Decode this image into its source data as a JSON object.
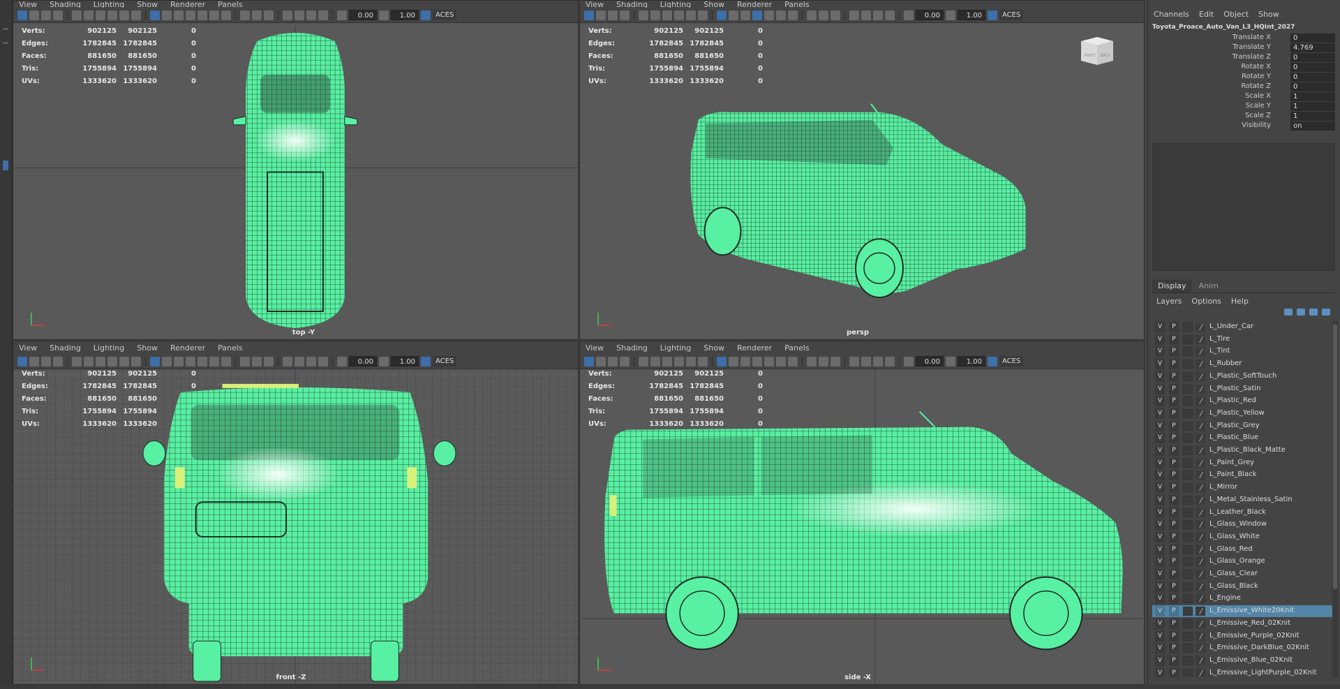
{
  "viewport_menu": [
    "View",
    "Shading",
    "Lighting",
    "Show",
    "Renderer",
    "Panels"
  ],
  "toolbar": {
    "value_a": "0.00",
    "value_b": "1.00",
    "color_space": "ACES"
  },
  "stats": {
    "rows": [
      {
        "label": "Verts:",
        "v1": "902125",
        "v2": "902125",
        "v3": "0"
      },
      {
        "label": "Edges:",
        "v1": "1782845",
        "v2": "1782845",
        "v3": "0"
      },
      {
        "label": "Faces:",
        "v1": "881650",
        "v2": "881650",
        "v3": "0"
      },
      {
        "label": "Tris:",
        "v1": "1755894",
        "v2": "1755894",
        "v3": "0"
      },
      {
        "label": "UVs:",
        "v1": "1333620",
        "v2": "1333620",
        "v3": "0"
      }
    ]
  },
  "viewports": {
    "top": {
      "label": "top -Y"
    },
    "persp": {
      "label": "persp",
      "cube_right": "RIGHT",
      "cube_back": "BACK"
    },
    "front": {
      "label": "front -Z"
    },
    "side": {
      "label": "side -X"
    }
  },
  "right_panel": {
    "menu": [
      "Channels",
      "Edit",
      "Object",
      "Show"
    ],
    "object_name": "Toyota_Proace_Auto_Van_L3_HQInt_2027",
    "attributes": [
      {
        "label": "Translate X",
        "value": "0"
      },
      {
        "label": "Translate Y",
        "value": "4.769"
      },
      {
        "label": "Translate Z",
        "value": "0"
      },
      {
        "label": "Rotate X",
        "value": "0"
      },
      {
        "label": "Rotate Y",
        "value": "0"
      },
      {
        "label": "Rotate Z",
        "value": "0"
      },
      {
        "label": "Scale X",
        "value": "1"
      },
      {
        "label": "Scale Y",
        "value": "1"
      },
      {
        "label": "Scale Z",
        "value": "1"
      },
      {
        "label": "Visibility",
        "value": "on"
      }
    ],
    "tabs": [
      "Display",
      "Anim"
    ],
    "submenu": [
      "Layers",
      "Options",
      "Help"
    ],
    "layer_v": "V",
    "layer_p": "P",
    "layers": [
      "L_Under_Car",
      "L_Tire",
      "L_Tint",
      "L_Rubber",
      "L_Plastic_SoftTouch",
      "L_Plastic_Satin",
      "L_Plastic_Red",
      "L_Plastic_Yellow",
      "L_Plastic_Grey",
      "L_Plastic_Blue",
      "L_Plastic_Black_Matte",
      "L_Paint_Grey",
      "L_Paint_Black",
      "L_Mirror",
      "L_Metal_Stainless_Satin",
      "L_Leather_Black",
      "L_Glass_Window",
      "L_Glass_White",
      "L_Glass_Red",
      "L_Glass_Orange",
      "L_Glass_Clear",
      "L_Glass_Black",
      "L_Engine",
      "L_Emissive_White20Knit",
      "L_Emissive_Red_02Knit",
      "L_Emissive_Purple_02Knit",
      "L_Emissive_DarkBlue_02Knit",
      "L_Emissive_Blue_02Knit",
      "L_Emissive_LightPurple_02Knit"
    ],
    "selected_layer": "L_Emissive_White20Knit"
  },
  "colors": {
    "wire": "#58f0a2",
    "viewport": "#595959",
    "selection": "#5285a6"
  }
}
